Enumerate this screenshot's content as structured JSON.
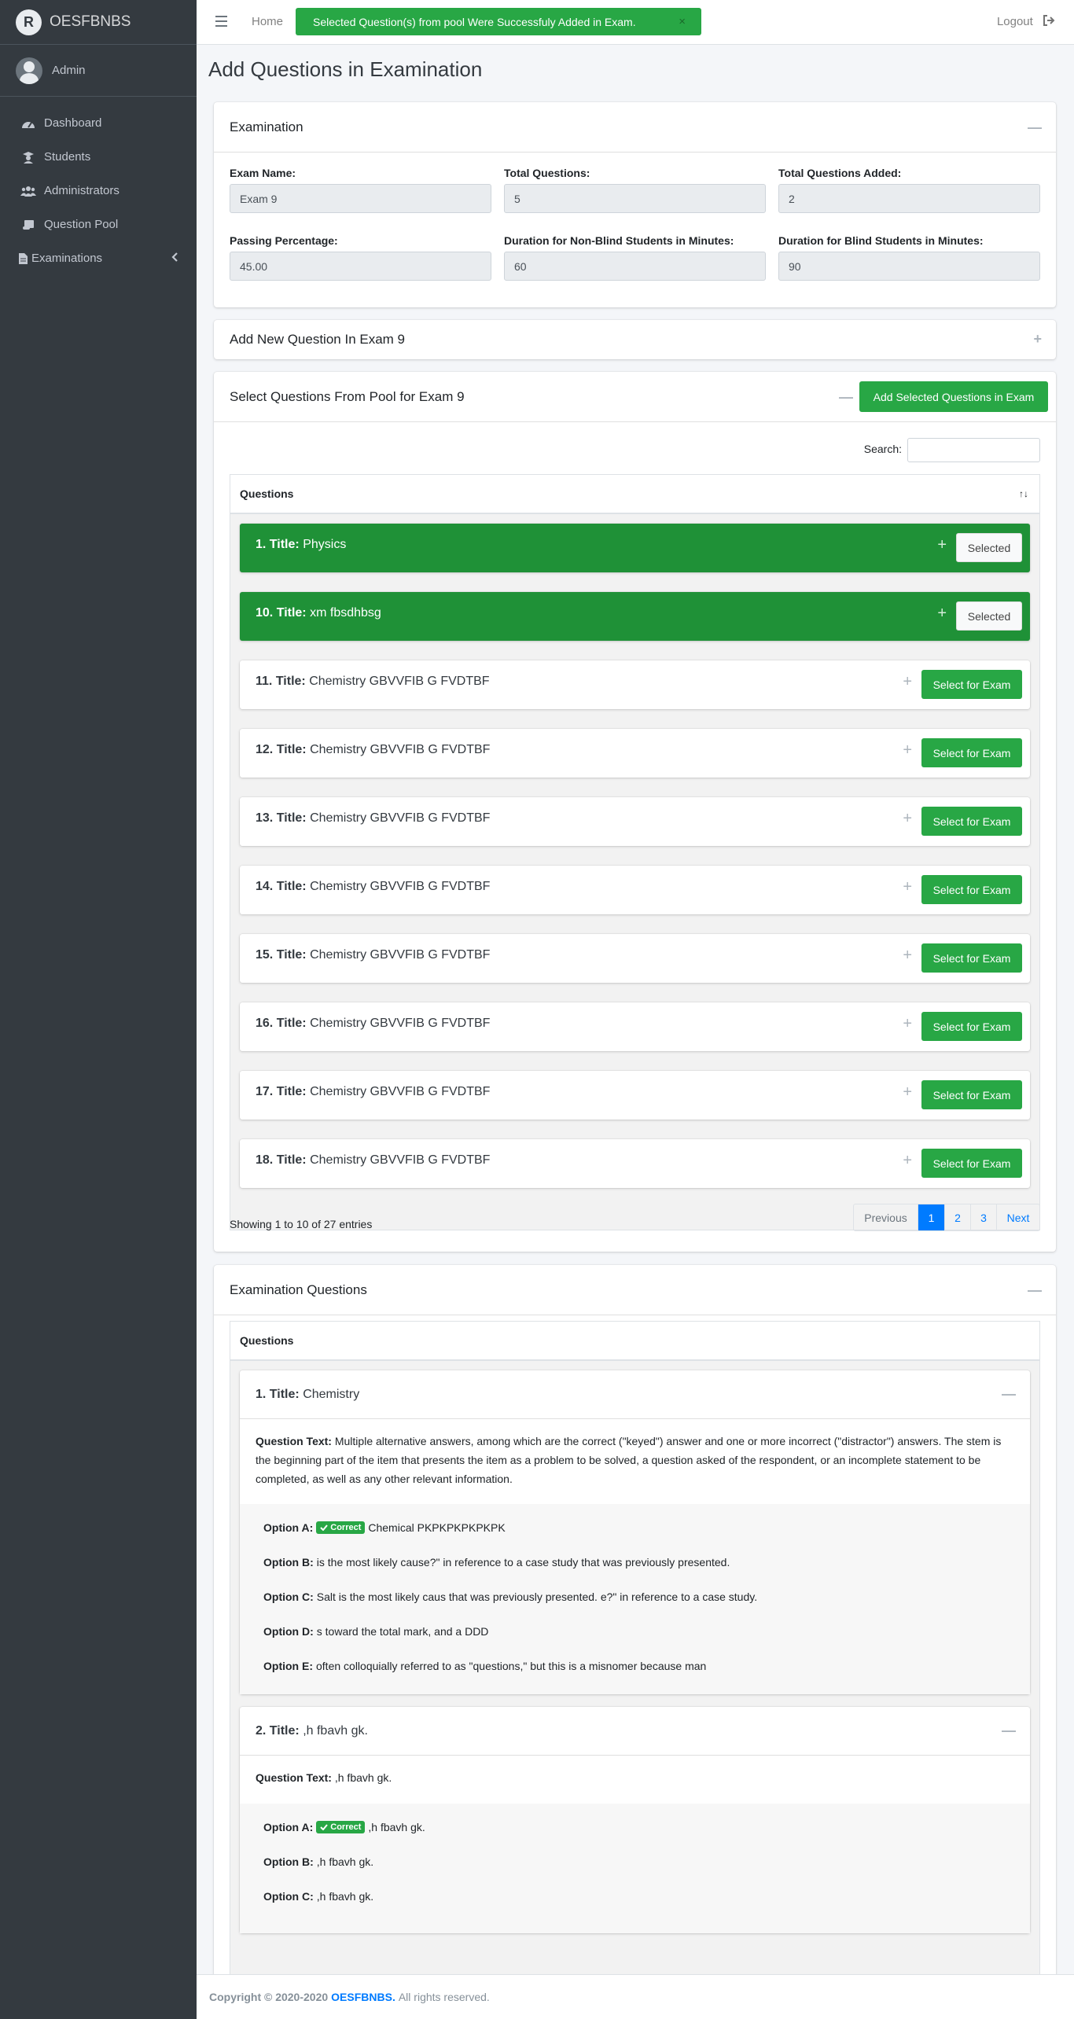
{
  "app": {
    "brand": "OESFBNBS",
    "brand_initial": "R",
    "user": "Admin"
  },
  "sidebar": {
    "items": [
      {
        "label": "Dashboard",
        "icon": "dashboard-icon"
      },
      {
        "label": "Students",
        "icon": "graduate-icon"
      },
      {
        "label": "Administrators",
        "icon": "users-icon"
      },
      {
        "label": "Question Pool",
        "icon": "scroll-icon"
      },
      {
        "label": "Examinations",
        "icon": "file-icon"
      }
    ]
  },
  "topbar": {
    "home": "Home",
    "toast": "Selected Question(s) from pool Were Successfuly Added in Exam.",
    "logout": "Logout",
    "toast_close": "×"
  },
  "page": {
    "title": "Add Questions in Examination"
  },
  "exam": {
    "header": "Examination",
    "name_label": "Exam Name:",
    "name": "Exam 9",
    "total_label": "Total Questions:",
    "total": "5",
    "added_label": "Total Questions Added:",
    "added": "2",
    "passing_label": "Passing Percentage:",
    "passing": "45.00",
    "nonblind_label": "Duration for Non-Blind Students in Minutes:",
    "nonblind": "60",
    "blind_label": "Duration for Blind Students in Minutes:",
    "blind": "90"
  },
  "add_new": {
    "header": "Add New Question In Exam 9"
  },
  "pool": {
    "header": "Select Questions From Pool for Exam 9",
    "add_button": "Add Selected Questions in Exam",
    "search_label": "Search:",
    "column": "Questions",
    "title_prefix": "Title:",
    "selected_label": "Selected",
    "select_label": "Select for Exam",
    "rows": [
      {
        "num": "1.",
        "title": "Physics",
        "selected": true
      },
      {
        "num": "10.",
        "title": "xm fbsdhbsg",
        "selected": true
      },
      {
        "num": "11.",
        "title": "Chemistry GBVVFIB G FVDTBF",
        "selected": false
      },
      {
        "num": "12.",
        "title": "Chemistry GBVVFIB G FVDTBF",
        "selected": false
      },
      {
        "num": "13.",
        "title": "Chemistry GBVVFIB G FVDTBF",
        "selected": false
      },
      {
        "num": "14.",
        "title": "Chemistry GBVVFIB G FVDTBF",
        "selected": false
      },
      {
        "num": "15.",
        "title": "Chemistry GBVVFIB G FVDTBF",
        "selected": false
      },
      {
        "num": "16.",
        "title": "Chemistry GBVVFIB G FVDTBF",
        "selected": false
      },
      {
        "num": "17.",
        "title": "Chemistry GBVVFIB G FVDTBF",
        "selected": false
      },
      {
        "num": "18.",
        "title": "Chemistry GBVVFIB G FVDTBF",
        "selected": false
      }
    ],
    "info": "Showing 1 to 10 of 27 entries",
    "pager": {
      "previous": "Previous",
      "pages": [
        "1",
        "2",
        "3"
      ],
      "next": "Next"
    }
  },
  "exam_questions": {
    "header": "Examination Questions",
    "column": "Questions",
    "qtext_label": "Question Text:",
    "correct_badge": "Correct",
    "items": [
      {
        "num": "1.",
        "title": "Chemistry",
        "text": "Multiple alternative answers, among which are the correct (\"keyed\") answer and one or more incorrect (\"distractor\") answers. The stem is the beginning part of the item that presents the item as a problem to be solved, a question asked of the respondent, or an incomplete statement to be completed, as well as any other relevant information.",
        "options": [
          {
            "label": "Option A:",
            "text": "Chemical PKPKPKPKPKPK",
            "correct": true
          },
          {
            "label": "Option B:",
            "text": "is the most likely cause?\" in reference to a case study that was previously presented.",
            "correct": false
          },
          {
            "label": "Option C:",
            "text": "Salt is the most likely caus that was previously presented. e?\" in reference to a case study.",
            "correct": false
          },
          {
            "label": "Option D:",
            "text": "s toward the total mark, and a DDD",
            "correct": false
          },
          {
            "label": "Option E:",
            "text": "often colloquially referred to as \"questions,\" but this is a misnomer because man",
            "correct": false
          }
        ]
      },
      {
        "num": "2.",
        "title": ",h fbavh gk.",
        "text": ",h fbavh gk.",
        "options": [
          {
            "label": "Option A:",
            "text": ",h fbavh gk.",
            "correct": true
          },
          {
            "label": "Option B:",
            "text": ",h fbavh gk.",
            "correct": false
          },
          {
            "label": "Option C:",
            "text": ",h fbavh gk.",
            "correct": false
          }
        ]
      }
    ]
  },
  "footer": {
    "copyright": "Copyright © 2020-2020",
    "brand": "OESFBNBS.",
    "rights": "All rights reserved."
  },
  "colors": {
    "sidebar": "#343a40",
    "success": "#28a745",
    "selected_row": "#1f9137",
    "primary": "#007bff"
  }
}
